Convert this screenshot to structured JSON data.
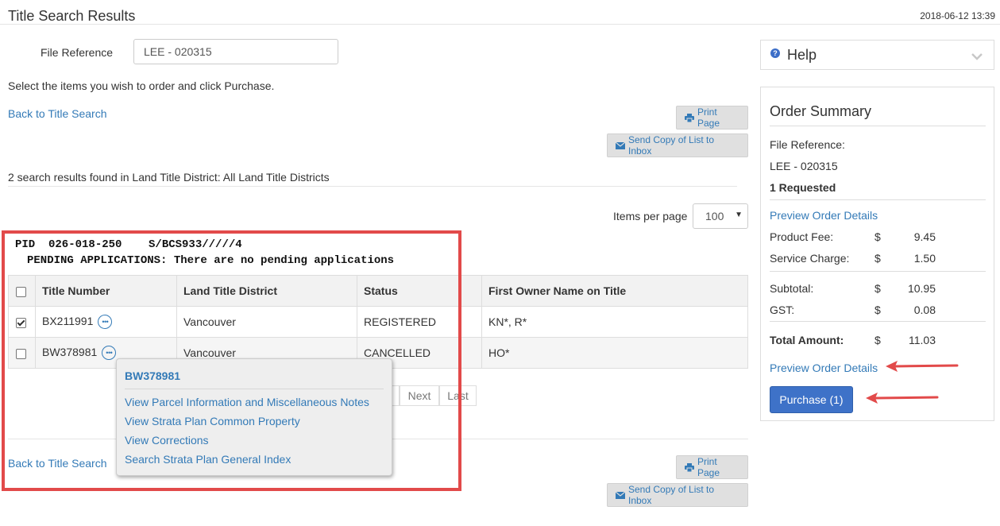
{
  "header": {
    "title": "Title Search Results",
    "timestamp": "2018-06-12 13:39"
  },
  "file_reference": {
    "label": "File Reference",
    "value": "LEE - 020315"
  },
  "instruction": "Select the items you wish to order and click Purchase.",
  "back_link": "Back to Title Search",
  "buttons": {
    "print": "Print Page",
    "send_copy": "Send Copy of List to Inbox"
  },
  "results_count": "2 search results found in Land Title District: All Land Title Districts",
  "items_per_page": {
    "label": "Items per page",
    "value": "100"
  },
  "pid_line": "PID  026-018-250    S/BCS933/////4",
  "pending_line": "PENDING APPLICATIONS: There are no pending applications",
  "table": {
    "headers": [
      "",
      "Title Number",
      "Land Title District",
      "Status",
      "First Owner Name on Title"
    ],
    "rows": [
      {
        "checked": true,
        "title_number": "BX211991",
        "district": "Vancouver",
        "status": "REGISTERED",
        "owner": "KN*, R*"
      },
      {
        "checked": false,
        "title_number": "BW378981",
        "district": "Vancouver",
        "status": "CANCELLED",
        "owner": "HO*"
      }
    ]
  },
  "pager": {
    "next": "Next",
    "last": "Last"
  },
  "popup": {
    "title": "BW378981",
    "links": [
      "View Parcel Information and Miscellaneous Notes",
      "View Strata Plan Common Property",
      "View Corrections",
      "Search Strata Plan General Index"
    ]
  },
  "help": {
    "title": "Help"
  },
  "order_summary": {
    "title": "Order Summary",
    "file_reference_label": "File Reference:",
    "file_reference_value": "LEE - 020315",
    "requested": "1 Requested",
    "preview_link": "Preview Order Details",
    "product_fee_label": "Product Fee:",
    "product_fee": "9.45",
    "service_charge_label": "Service Charge:",
    "service_charge": "1.50",
    "subtotal_label": "Subtotal:",
    "subtotal": "10.95",
    "gst_label": "GST:",
    "gst": "0.08",
    "total_label": "Total Amount:",
    "total": "11.03",
    "currency": "$",
    "purchase_button": "Purchase (1)"
  },
  "colors": {
    "link": "#337ab7",
    "highlight_red": "#e24a4a",
    "purchase_blue": "#3e72c8"
  }
}
